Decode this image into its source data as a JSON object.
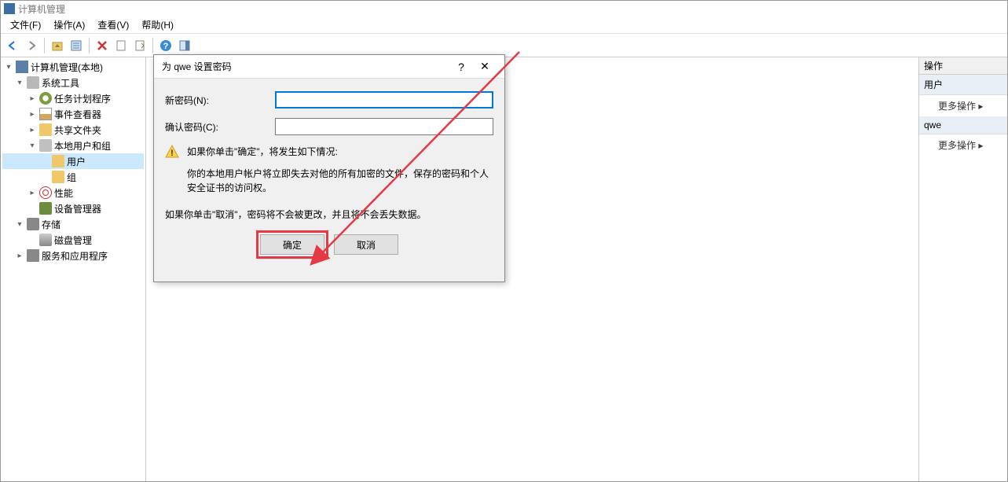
{
  "window": {
    "title": "计算机管理"
  },
  "menu": {
    "file": "文件(F)",
    "action": "操作(A)",
    "view": "查看(V)",
    "help": "帮助(H)"
  },
  "tree": {
    "root": "计算机管理(本地)",
    "system_tools": "系统工具",
    "task_scheduler": "任务计划程序",
    "event_viewer": "事件查看器",
    "shared_folders": "共享文件夹",
    "local_users_groups": "本地用户和组",
    "users": "用户",
    "groups": "组",
    "performance": "性能",
    "device_manager": "设备管理器",
    "storage": "存储",
    "disk_mgmt": "磁盘管理",
    "services_apps": "服务和应用程序"
  },
  "actions": {
    "header": "操作",
    "section1": "用户",
    "more1": "更多操作",
    "section2": "qwe",
    "more2": "更多操作"
  },
  "dialog": {
    "title": "为 qwe 设置密码",
    "new_password_label": "新密码(N):",
    "confirm_password_label": "确认密码(C):",
    "warning_line": "如果你单击\"确定\"，将发生如下情况:",
    "warning_body": "你的本地用户帐户将立即失去对他的所有加密的文件，保存的密码和个人安全证书的访问权。",
    "cancel_info": "如果你单击\"取消\"，密码将不会被更改，并且将不会丢失数据。",
    "ok": "确定",
    "cancel": "取消"
  }
}
